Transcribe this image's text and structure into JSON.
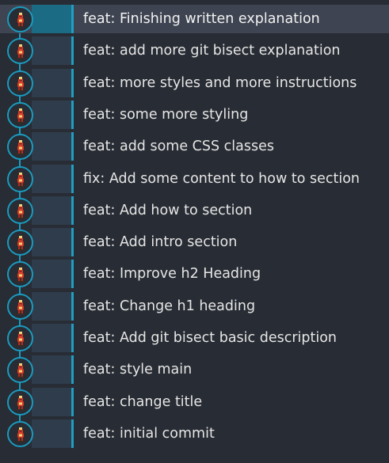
{
  "graph": {
    "line_color": "#1a9bbf",
    "selected_index": 0,
    "avatar_icon": "user-avatar-icon",
    "commits": [
      {
        "message": "feat: Finishing written explanation"
      },
      {
        "message": "feat: add more git bisect explanation"
      },
      {
        "message": "feat: more styles and more instructions"
      },
      {
        "message": "feat: some more styling"
      },
      {
        "message": "feat: add some CSS classes"
      },
      {
        "message": "fix: Add some content to how to section"
      },
      {
        "message": "feat: Add how to section"
      },
      {
        "message": "feat: Add intro section"
      },
      {
        "message": "feat: Improve h2 Heading"
      },
      {
        "message": "feat: Change h1 heading"
      },
      {
        "message": "feat: Add git bisect basic description"
      },
      {
        "message": "feat: style main"
      },
      {
        "message": "feat: change title"
      },
      {
        "message": "feat: initial commit"
      }
    ]
  }
}
